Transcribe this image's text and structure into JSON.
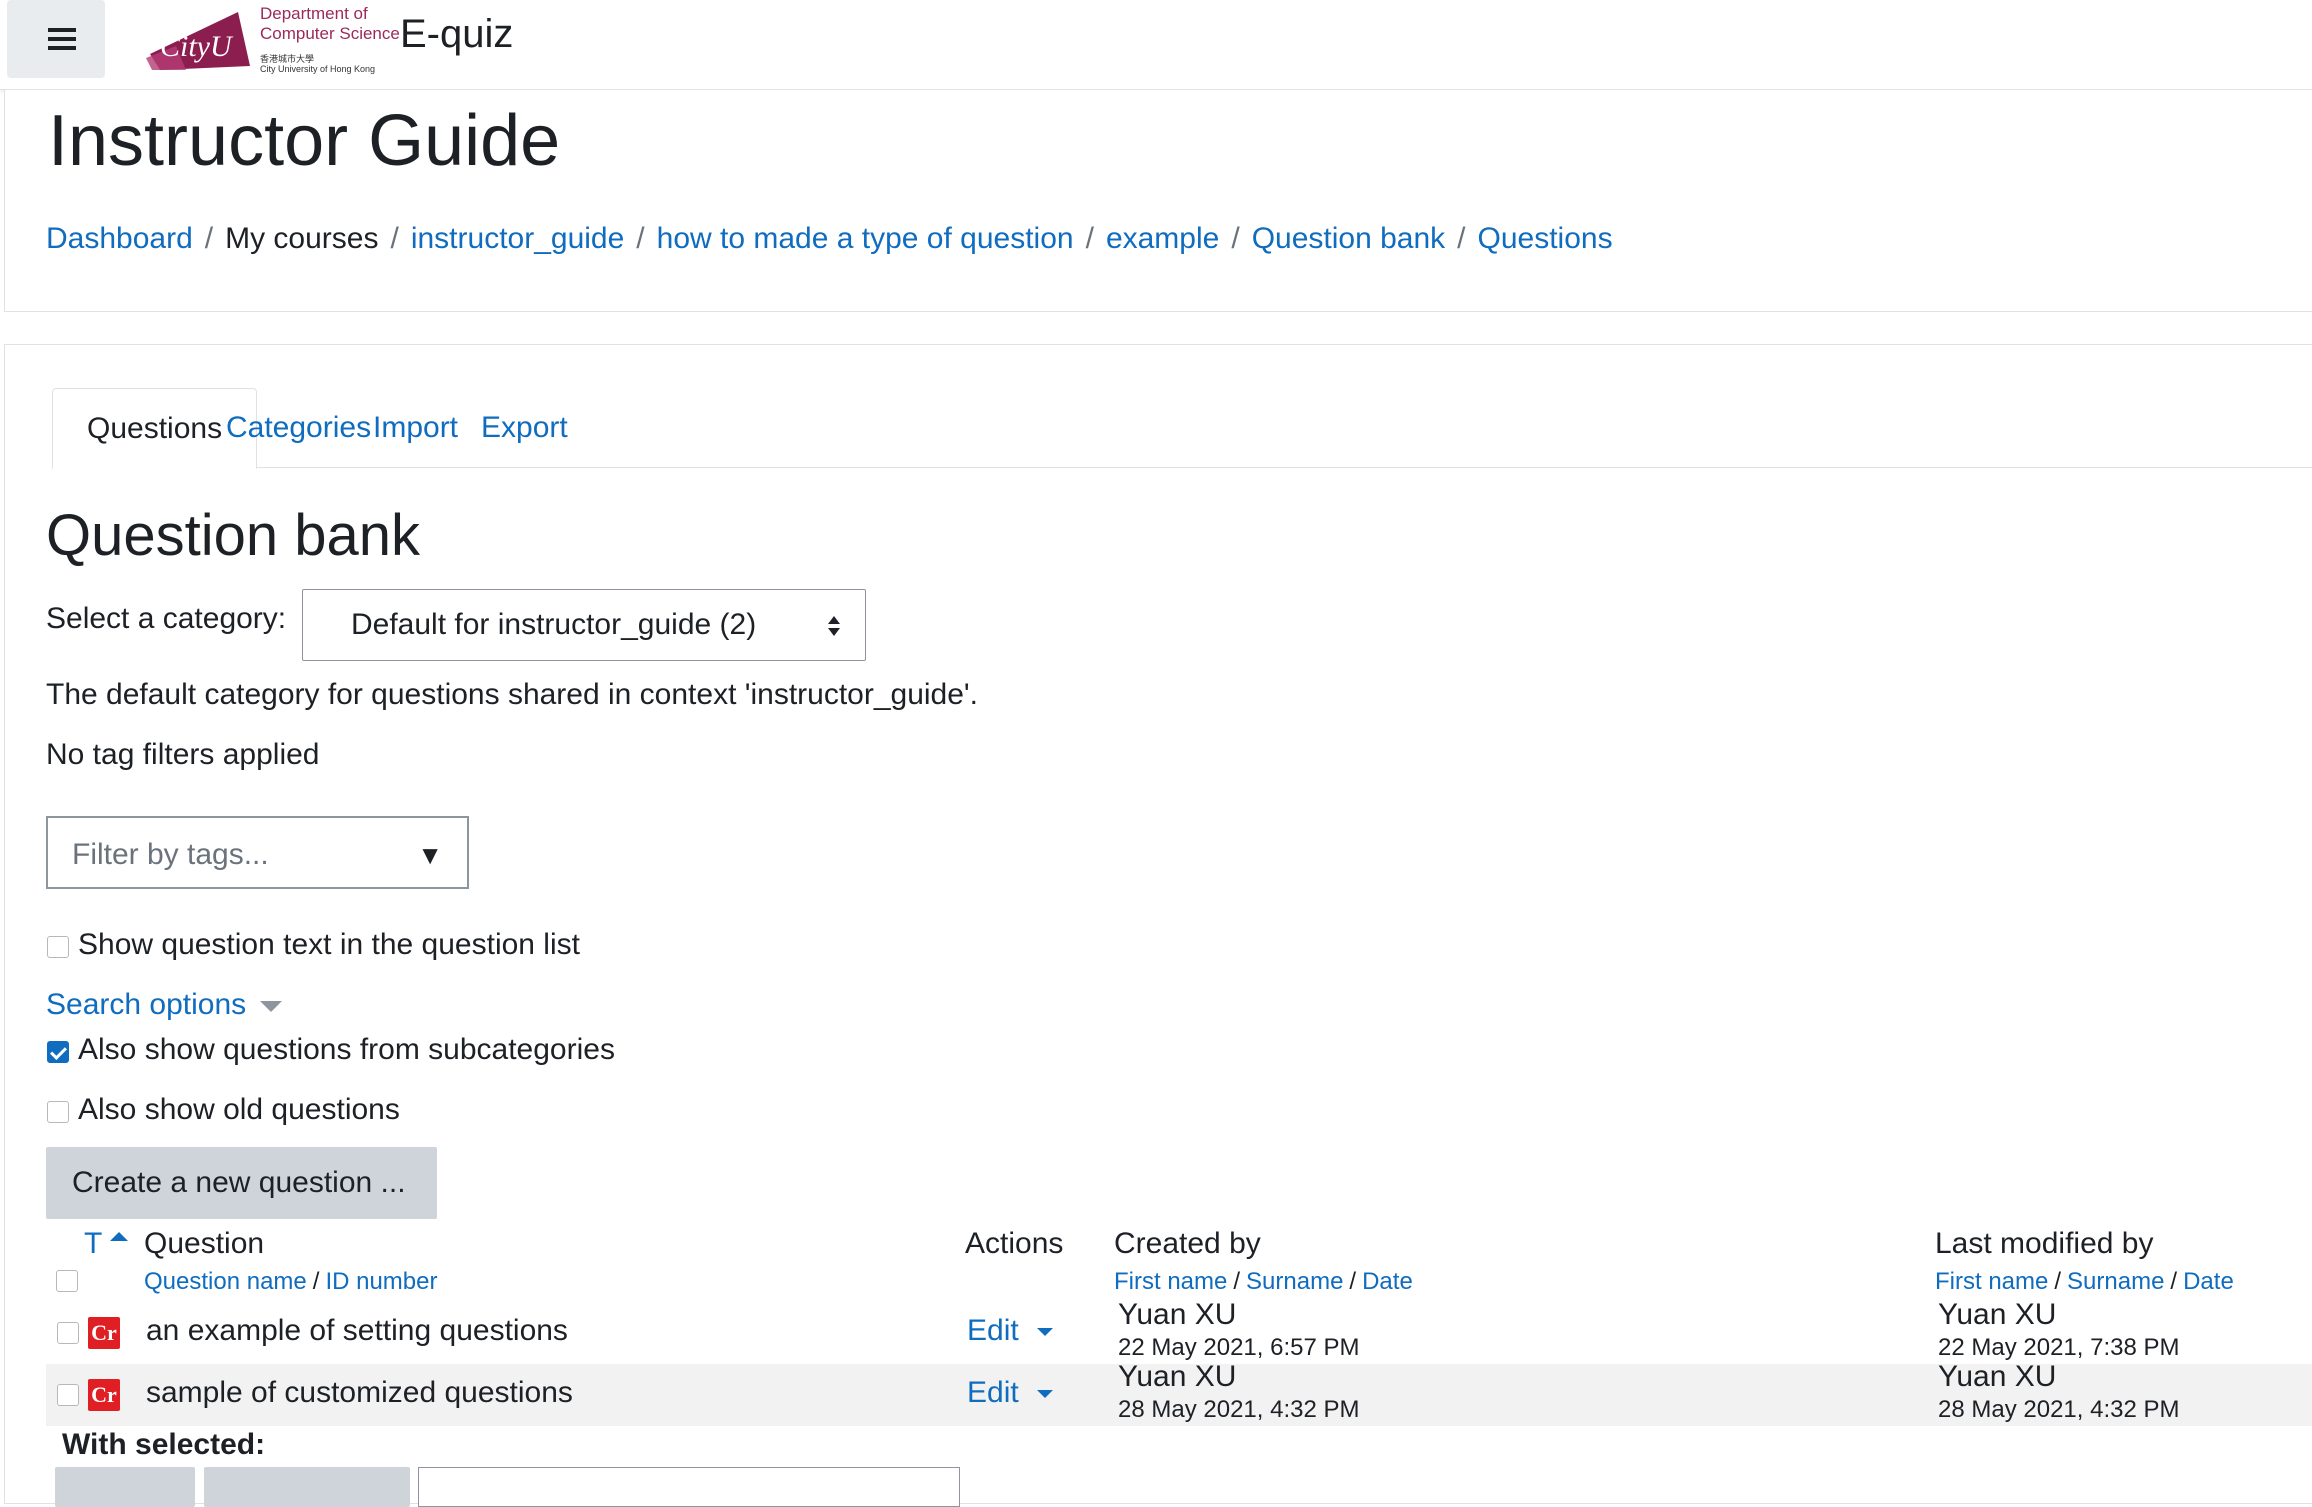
{
  "navbar": {
    "logo": {
      "brand": "CityU",
      "line1": "Department of",
      "line2": "Computer Science",
      "line3": "香港城市大學",
      "line4": "City University of Hong Kong"
    },
    "site_name": "E-quiz"
  },
  "page": {
    "title": "Instructor Guide"
  },
  "breadcrumb": [
    {
      "label": "Dashboard",
      "link": true
    },
    {
      "label": "My courses",
      "link": false
    },
    {
      "label": "instructor_guide",
      "link": true
    },
    {
      "label": "how to made a type of question",
      "link": true
    },
    {
      "label": "example",
      "link": true
    },
    {
      "label": "Question bank",
      "link": true
    },
    {
      "label": "Questions",
      "link": true
    }
  ],
  "tabs": [
    {
      "label": "Questions",
      "active": true
    },
    {
      "label": "Categories",
      "active": false
    },
    {
      "label": "Import",
      "active": false
    },
    {
      "label": "Export",
      "active": false
    }
  ],
  "question_bank": {
    "heading": "Question bank",
    "select_label": "Select a category:",
    "selected_category": "Default for instructor_guide (2)",
    "category_description": "The default category for questions shared in context 'instructor_guide'.",
    "tag_status": "No tag filters applied",
    "tag_filter_placeholder": "Filter by tags...",
    "show_question_text_label": "Show question text in the question list",
    "show_question_text_checked": false,
    "search_options_label": "Search options",
    "subcategories_label": "Also show questions from subcategories",
    "subcategories_checked": true,
    "old_questions_label": "Also show old questions",
    "old_questions_checked": false,
    "create_button": "Create a new question ..."
  },
  "table": {
    "headers": {
      "type": "T",
      "question": "Question",
      "question_sort": [
        "Question name",
        "ID number"
      ],
      "actions": "Actions",
      "created_by": "Created by",
      "created_sort": [
        "First name",
        "Surname",
        "Date"
      ],
      "modified_by": "Last modified by",
      "modified_sort": [
        "First name",
        "Surname",
        "Date"
      ]
    },
    "rows": [
      {
        "type_icon": "Cr",
        "name": "an example of setting questions",
        "action": "Edit",
        "created_by": "Yuan XU",
        "created_date": "22 May 2021, 6:57 PM",
        "modified_by": "Yuan XU",
        "modified_date": "22 May 2021, 7:38 PM"
      },
      {
        "type_icon": "Cr",
        "name": "sample of customized questions",
        "action": "Edit",
        "created_by": "Yuan XU",
        "created_date": "28 May 2021, 4:32 PM",
        "modified_by": "Yuan XU",
        "modified_date": "28 May 2021, 4:32 PM"
      }
    ],
    "with_selected": "With selected:"
  },
  "colors": {
    "link": "#0f6cbf",
    "text": "#1d2125",
    "button_bg": "#ced4da",
    "qtype_icon": "#e01f25",
    "brand": "#9b2a5a"
  },
  "icons": {
    "menu": "hamburger-icon",
    "select_arrows": "sort-arrows-icon",
    "tag_dropdown": "triangle-down-icon",
    "search_options": "caret-down-icon",
    "sort": "sort-asc-icon",
    "qtype": "coderunner-icon"
  }
}
